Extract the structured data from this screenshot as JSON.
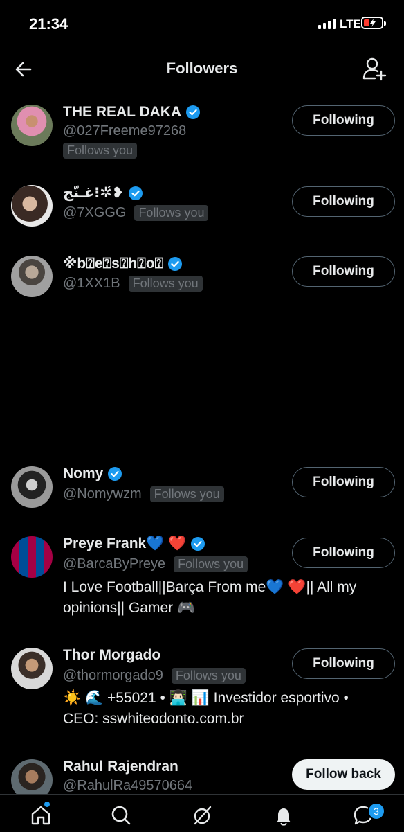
{
  "status": {
    "time": "21:34",
    "network": "LTE"
  },
  "header": {
    "title": "Followers"
  },
  "colors": {
    "accent": "#1d9bf0",
    "background": "#000000",
    "muted": "#71767b",
    "battery_low": "#ff3b30"
  },
  "followers": [
    {
      "name": "THE REAL DAKA",
      "handle": "@027Freeme97268",
      "follows_you": "Follows you",
      "button": "Following",
      "verified": true
    },
    {
      "name": "غـنّج⁝✲❥́",
      "handle": "@7XGGG",
      "follows_you": "Follows you",
      "button": "Following",
      "verified": true
    },
    {
      "name": "※b⍰e⍰s⍰h⍰o⍰",
      "handle": "@1XX1B",
      "follows_you": "Follows you",
      "button": "Following",
      "verified": true
    },
    {
      "name": "Nomy",
      "handle": "@Nomywzm",
      "follows_you": "Follows you",
      "button": "Following",
      "verified": true
    },
    {
      "name": "Preye Frank💙 ❤️",
      "handle": "@BarcaByPreye",
      "follows_you": "Follows you",
      "button": "Following",
      "verified": true,
      "bio": "I Love Football||Barça From me💙 ❤️|| All my opinions|| Gamer 🎮"
    },
    {
      "name": "Thor Morgado",
      "handle": "@thormorgado9",
      "follows_you": "Follows you",
      "button": "Following",
      "verified": false,
      "bio": "☀️ 🌊 +55021 • 👨🏻‍💻 📊 Investidor esportivo • CEO: sswhiteodonto.com.br"
    },
    {
      "name": "Rahul Rajendran",
      "handle": "@RahulRa49570664",
      "button": "Follow back",
      "verified": false
    }
  ],
  "tabbar": {
    "icons": [
      "home-icon",
      "search-icon",
      "grok-icon",
      "notifications-icon",
      "messages-icon"
    ],
    "messages_badge": "3"
  }
}
